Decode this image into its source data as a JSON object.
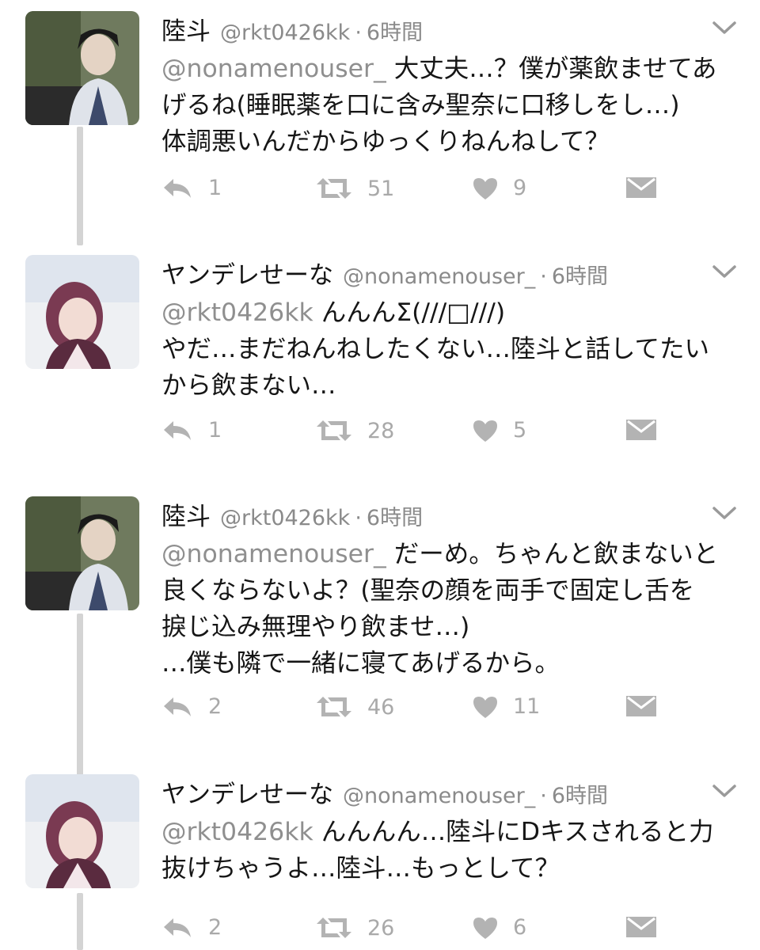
{
  "tweets": [
    {
      "name": "陸斗",
      "handle": "@rkt0426kk",
      "separator": "·",
      "time": "6時間",
      "mention": "@nonamenouser_",
      "lines": [
        "大丈夫…？僕が薬飲ませてあ",
        "げるね(睡眠薬を口に含み聖奈に口移しをし…)",
        "体調悪いんだからゆっくりねんねして？"
      ],
      "reply_count": "1",
      "retweet_count": "51",
      "like_count": "9"
    },
    {
      "name": "ヤンデレせーな",
      "handle": "@nonamenouser_",
      "separator": "·",
      "time": "6時間",
      "mention": "@rkt0426kk",
      "lines": [
        "んんんΣ(///□///)",
        "やだ…まだねんねしたくない…陸斗と話してたい",
        "から飲まない…"
      ],
      "reply_count": "1",
      "retweet_count": "28",
      "like_count": "5"
    },
    {
      "name": "陸斗",
      "handle": "@rkt0426kk",
      "separator": "·",
      "time": "6時間",
      "mention": "@nonamenouser_",
      "lines": [
        "だーめ。ちゃんと飲まないと",
        "良くならないよ？(聖奈の顔を両手で固定し舌を",
        "捩じ込み無理やり飲ませ…)",
        "…僕も隣で一緒に寝てあげるから。"
      ],
      "reply_count": "2",
      "retweet_count": "46",
      "like_count": "11"
    },
    {
      "name": "ヤンデレせーな",
      "handle": "@nonamenouser_",
      "separator": "·",
      "time": "6時間",
      "mention": "@rkt0426kk",
      "lines": [
        "んんんん…陸斗にDキスされると力",
        "抜けちゃうよ…陸斗…もっとして？"
      ],
      "reply_count": "2",
      "retweet_count": "26",
      "like_count": "6"
    }
  ],
  "icons": {
    "reply": "reply-icon",
    "retweet": "retweet-icon",
    "like": "heart-icon",
    "dm": "envelope-icon",
    "more": "chevron-down-icon"
  },
  "colors": {
    "action_icon": "#b3b3b3",
    "handle_text": "#8a8a8a",
    "thread_line": "#d4d4d4"
  }
}
